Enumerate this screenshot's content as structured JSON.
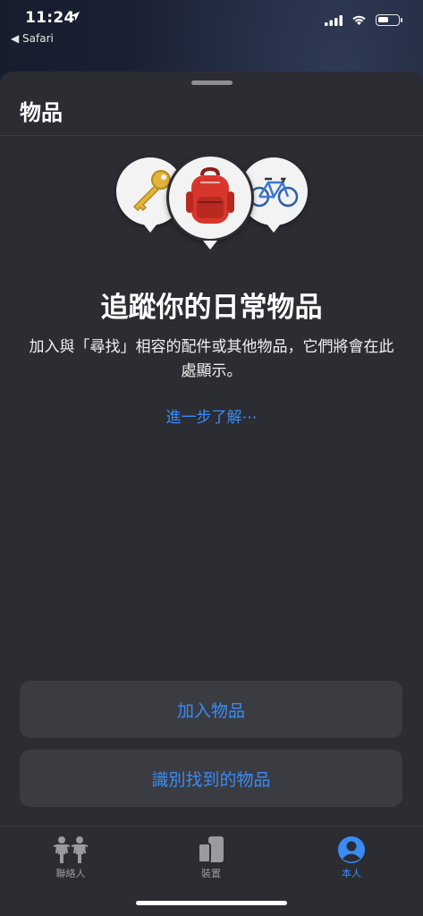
{
  "status": {
    "time": "11:24",
    "back_app": "◀ Safari"
  },
  "sheet": {
    "title": "物品"
  },
  "icons": {
    "pin_left": "key-icon",
    "pin_center": "backpack-icon",
    "pin_right": "bicycle-icon"
  },
  "empty_state": {
    "headline": "追蹤你的日常物品",
    "description": "加入與「尋找」相容的配件或其他物品，它們將會在此處顯示。",
    "learn_more": "進一步了解⋯"
  },
  "actions": {
    "add_item": "加入物品",
    "identify_item": "識別找到的物品"
  },
  "tabs": [
    {
      "label": "聯絡人",
      "icon": "people-icon",
      "active": false
    },
    {
      "label": "裝置",
      "icon": "devices-icon",
      "active": false
    },
    {
      "label": "本人",
      "icon": "me-icon",
      "active": true
    }
  ],
  "colors": {
    "accent": "#3b8bf5",
    "sheet_bg": "#2b2d32",
    "button_bg": "#3a3c42"
  },
  "battery_level": 0.55
}
